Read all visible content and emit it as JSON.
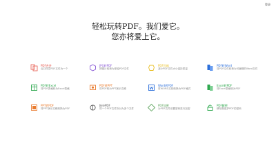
{
  "topbar": {
    "login": "登录"
  },
  "hero": {
    "line1": "轻松玩转PDF。我们爱它。",
    "line2": "您亦将爱上它。"
  },
  "tools": [
    {
      "title": "PDF合并",
      "desc": "合并任意PDF文件为一个",
      "icon": "merge-icon",
      "color": "#e6574c"
    },
    {
      "title": "JPG转PDF",
      "desc": "把图片转换为单独PDF文件",
      "icon": "image-to-pdf-icon",
      "color": "#8a5ad6"
    },
    {
      "title": "PDF压缩",
      "desc": "减小PDF文件大小保持质量",
      "icon": "compress-icon",
      "color": "#e9c02a"
    },
    {
      "title": "PDF转Word",
      "desc": "将PDF文件转换为可编辑的Word文件",
      "icon": "pdf-to-word-icon",
      "color": "#2c6fda"
    },
    {
      "title": "PDF转Excel",
      "desc": "将PDF表格转为Excel表格",
      "icon": "pdf-to-excel-icon",
      "color": "#2fa84f"
    },
    {
      "title": "PDF转PPT",
      "desc": "将PDF转为PPT演示文稿",
      "icon": "pdf-to-ppt-icon",
      "color": "#e97b2e"
    },
    {
      "title": "Word转PDF",
      "desc": "将WORD文档转换为PDF格式",
      "icon": "word-to-pdf-icon",
      "color": "#2c6fda"
    },
    {
      "title": "Excel转PDF",
      "desc": "将Excel表格转为PDF",
      "icon": "excel-to-pdf-icon",
      "color": "#2fa84f"
    },
    {
      "title": "PPT转PDF",
      "desc": "将PPT演示文稿转换为PDF",
      "icon": "ppt-to-pdf-icon",
      "color": "#e97b2e"
    },
    {
      "title": "拆分PDF",
      "desc": "将一个PDF文件拆分为多个文件",
      "icon": "split-icon",
      "color": "#555555"
    },
    {
      "title": "PDF加密",
      "desc": "为PDF文件设置密码进行加密",
      "icon": "lock-icon",
      "color": "#5aa25a"
    },
    {
      "title": "PDF解密",
      "desc": "移除受保护PDF的密码",
      "icon": "unlock-icon",
      "color": "#2fa84f"
    }
  ]
}
